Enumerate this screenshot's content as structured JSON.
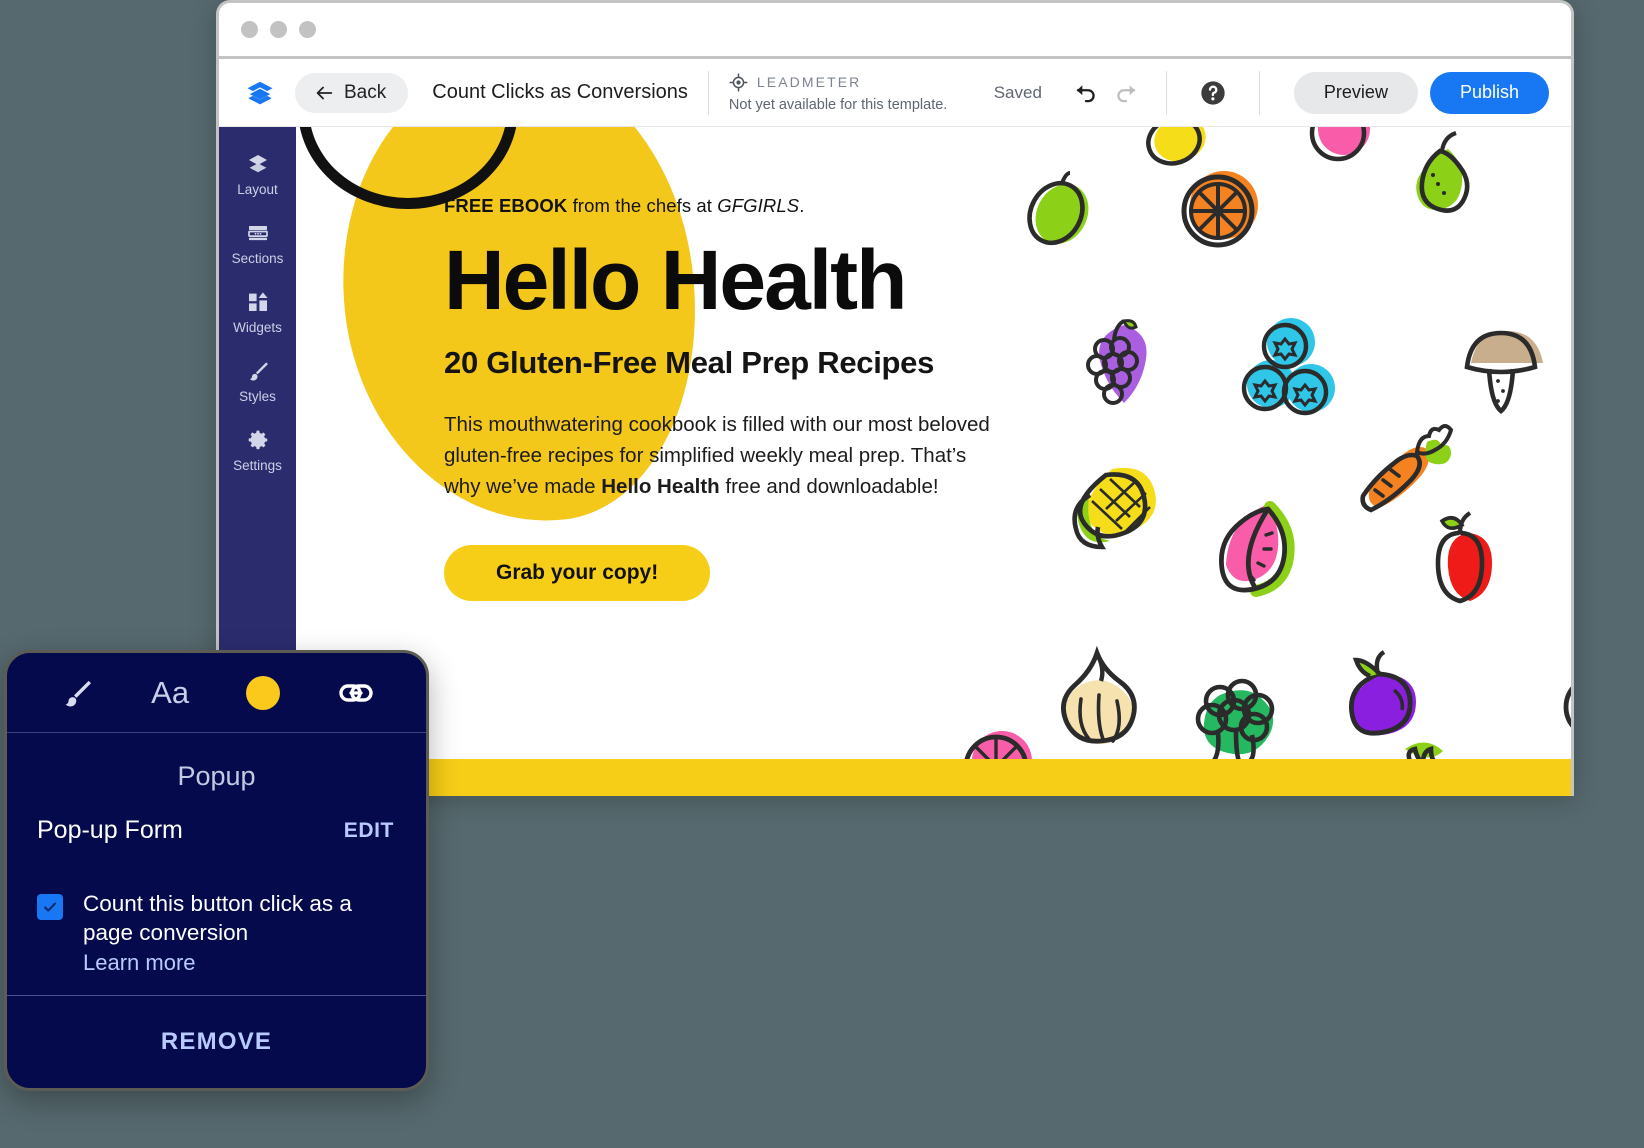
{
  "window": {
    "traffic_lights": [
      "dot-1",
      "dot-2",
      "dot-3"
    ]
  },
  "toolbar": {
    "logo_icon": "layers-logo-icon",
    "back_label": "Back",
    "back_icon": "arrow-left-icon",
    "title": "Count Clicks as Conversions",
    "leadmeter_icon": "target-icon",
    "leadmeter_label": "LEADMETER",
    "leadmeter_sub": "Not yet available for this template.",
    "saved_label": "Saved",
    "undo_icon": "undo-icon",
    "redo_icon": "redo-icon",
    "help_icon": "help-circle-icon",
    "preview_label": "Preview",
    "publish_label": "Publish",
    "publish_color": "#1877f2"
  },
  "sidebar": {
    "background": "#2b2c6e",
    "items": [
      {
        "label": "Layout",
        "icon": "layers-icon"
      },
      {
        "label": "Sections",
        "icon": "sections-icon"
      },
      {
        "label": "Widgets",
        "icon": "widgets-icon"
      },
      {
        "label": "Styles",
        "icon": "brush-icon"
      },
      {
        "label": "Settings",
        "icon": "gear-icon"
      }
    ]
  },
  "hero": {
    "blob_color": "#F4C71B",
    "eyebrow_strong": "FREE EBOOK",
    "eyebrow_rest": " from the chefs at ",
    "eyebrow_italic": "GFGIRLS",
    "eyebrow_end": ".",
    "title": "Hello Health",
    "subtitle": "20 Gluten-Free Meal Prep Recipes",
    "body_part1": "This mouthwatering cookbook is filled with our most beloved gluten-free recipes for simplified weekly meal prep. That’s why we’ve made ",
    "body_bold": "Hello Health",
    "body_part2": " free and downloadable!",
    "cta_label": "Grab your copy!",
    "cta_color": "#F7CE17",
    "footer_bar_color": "#F7CE17"
  },
  "food_illustrations": [
    {
      "name": "lime-icon",
      "color": "#8CD117"
    },
    {
      "name": "orange-slice-icon",
      "color": "#F58220"
    },
    {
      "name": "lemon-icon",
      "color": "#F5DE19"
    },
    {
      "name": "pear-icon",
      "color": "#8CD117"
    },
    {
      "name": "grapes-icon",
      "color": "#A95FE0"
    },
    {
      "name": "blueberries-icon",
      "color": "#2FC6E8"
    },
    {
      "name": "mushroom-icon",
      "color": "#C9AE8E"
    },
    {
      "name": "carrot-icon",
      "color": "#F58220"
    },
    {
      "name": "corn-icon",
      "color": "#F5DE19"
    },
    {
      "name": "watermelon-icon",
      "color": "#F95CA8"
    },
    {
      "name": "apple-icon",
      "color": "#EE1B19"
    },
    {
      "name": "garlic-icon",
      "color": "#F6E2AE"
    },
    {
      "name": "broccoli-icon",
      "color": "#26B761"
    },
    {
      "name": "eggplant-icon",
      "color": "#8B1FE0"
    },
    {
      "name": "chili-icon",
      "color": "#EE1B19"
    },
    {
      "name": "kiwi-icon",
      "color": "#A97C50"
    },
    {
      "name": "tomato-icon",
      "color": "#F95CA8"
    }
  ],
  "popup": {
    "background": "#040a4c",
    "tools": [
      {
        "name": "brush-tool",
        "icon": "brush-icon"
      },
      {
        "name": "font-tool",
        "icon": "Aa"
      },
      {
        "name": "color-tool",
        "icon": "color-swatch-icon",
        "color": "#FBC91B"
      },
      {
        "name": "link-tool",
        "icon": "link-icon"
      }
    ],
    "section_title": "Popup",
    "row_label": "Pop-up Form",
    "edit_label": "EDIT",
    "checkbox_checked": true,
    "checkbox_label": "Count this button click as a page conversion",
    "learn_more_label": "Learn more",
    "remove_label": "REMOVE"
  }
}
